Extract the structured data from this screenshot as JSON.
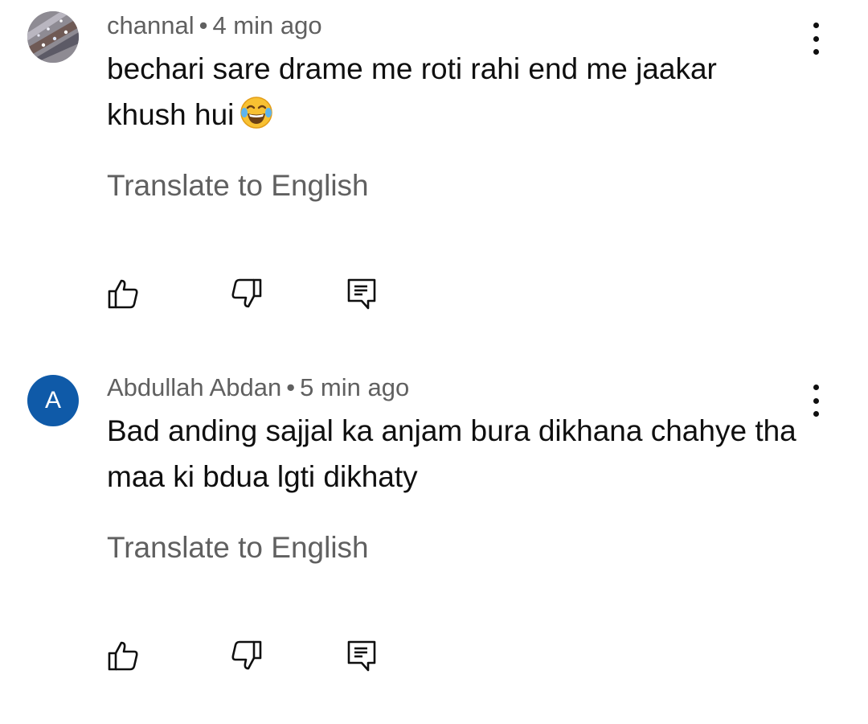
{
  "comments": [
    {
      "author": "channal",
      "separator": "•",
      "time": "4 min ago",
      "text": "bechari sare drame me roti rahi end me jaakar khush hui",
      "emoji": "face-with-tears-of-joy-icon",
      "translate_label": "Translate to English",
      "avatar_type": "photo"
    },
    {
      "author": "Abdullah Abdan",
      "separator": "•",
      "time": "5 min ago",
      "text": "Bad anding sajjal ka anjam bura dikhana chahye tha maa ki bdua lgti dikhaty",
      "avatar_letter": "A",
      "avatar_color": "#0f5aa8",
      "translate_label": "Translate to English",
      "avatar_type": "letter"
    }
  ],
  "icons": {
    "like": "thumb-up-outline-icon",
    "dislike": "thumb-down-outline-icon",
    "reply": "comment-reply-icon",
    "more": "more-vertical-icon"
  },
  "colors": {
    "meta_text": "#606060",
    "body_text": "#0f0f0f",
    "avatar_letter_bg": "#0f5aa8"
  }
}
